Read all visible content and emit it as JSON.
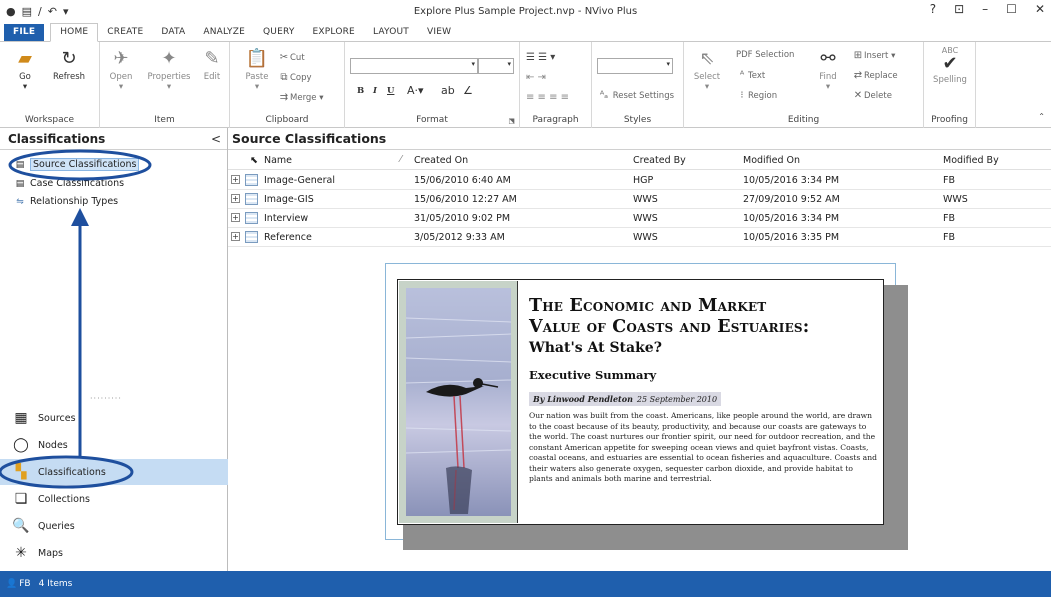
{
  "window": {
    "title": "Explore Plus Sample Project.nvp - NVivo Plus",
    "controls": [
      "?",
      "⊡",
      "–",
      "☐",
      "✕"
    ]
  },
  "ribbon_tabs": [
    "FILE",
    "HOME",
    "CREATE",
    "DATA",
    "ANALYZE",
    "QUERY",
    "EXPLORE",
    "LAYOUT",
    "VIEW"
  ],
  "ribbon": {
    "workspace": {
      "label": "Workspace",
      "go": "Go",
      "refresh": "Refresh"
    },
    "item": {
      "label": "Item",
      "open": "Open",
      "properties": "Properties",
      "edit": "Edit"
    },
    "clipboard": {
      "label": "Clipboard",
      "paste": "Paste",
      "cut": "Cut",
      "copy": "Copy",
      "merge": "Merge"
    },
    "format": {
      "label": "Format",
      "bold": "B",
      "italic": "I",
      "underline": "U"
    },
    "paragraph": {
      "label": "Paragraph"
    },
    "styles": {
      "label": "Styles",
      "reset": "Reset Settings"
    },
    "editing": {
      "label": "Editing",
      "select": "Select",
      "pdf_selection": "PDF Selection",
      "text": "Text",
      "region": "Region",
      "find": "Find",
      "insert": "Insert",
      "replace": "Replace",
      "delete": "Delete"
    },
    "proofing": {
      "label": "Proofing",
      "abc": "ABC",
      "spelling": "Spelling"
    }
  },
  "nav": {
    "header": "Classifications",
    "collapse": "<",
    "tree": [
      {
        "label": "Source Classifications",
        "selected": true
      },
      {
        "label": "Case Classifications",
        "selected": false
      },
      {
        "label": "Relationship Types",
        "selected": false
      }
    ],
    "buttons": [
      {
        "label": "Sources",
        "icon": "sources-icon"
      },
      {
        "label": "Nodes",
        "icon": "nodes-icon"
      },
      {
        "label": "Classifications",
        "icon": "classifications-icon",
        "active": true
      },
      {
        "label": "Collections",
        "icon": "collections-icon"
      },
      {
        "label": "Queries",
        "icon": "queries-icon"
      },
      {
        "label": "Maps",
        "icon": "maps-icon"
      }
    ]
  },
  "main": {
    "title": "Source Classifications",
    "columns": [
      "Name",
      "Created On",
      "Created By",
      "Modified On",
      "Modified By"
    ],
    "rows": [
      {
        "name": "Image-General",
        "created_on": "15/06/2010 6:40 AM",
        "created_by": "HGP",
        "modified_on": "10/05/2016 3:34 PM",
        "modified_by": "FB"
      },
      {
        "name": "Image-GIS",
        "created_on": "15/06/2010 12:27 AM",
        "created_by": "WWS",
        "modified_on": "27/09/2010 9:52 AM",
        "modified_by": "WWS"
      },
      {
        "name": "Interview",
        "created_on": "31/05/2010 9:02 PM",
        "created_by": "WWS",
        "modified_on": "10/05/2016 3:34 PM",
        "modified_by": "FB"
      },
      {
        "name": "Reference",
        "created_on": "3/05/2012 9:33 AM",
        "created_by": "WWS",
        "modified_on": "10/05/2016 3:35 PM",
        "modified_by": "FB"
      }
    ]
  },
  "preview": {
    "title_line1": "The Economic and Market",
    "title_line2": "Value of Coasts and Estuaries:",
    "subtitle": "What's At Stake?",
    "section": "Executive Summary",
    "byline": "By Linwood Pendleton",
    "date": "25 September 2010",
    "body": "Our nation was built from the coast. Americans, like people around the world, are drawn to the coast because of its beauty, productivity, and because our coasts are gateways to the world. The coast nurtures our frontier spirit, our need for outdoor recreation, and the constant American appetite for sweeping ocean views and quiet bayfront vistas. Coasts, coastal oceans, and estuaries are essential to ocean fisheries and aquaculture. Coasts and their waters also generate oxygen, sequester carbon dioxide, and provide habitat to plants and animals both marine and terrestrial."
  },
  "status": {
    "user": "FB",
    "count": "4 Items"
  },
  "colors": {
    "accent": "#1f5fad",
    "annotation": "#1e4f9e",
    "selected_nav": "#c5dcf3"
  }
}
